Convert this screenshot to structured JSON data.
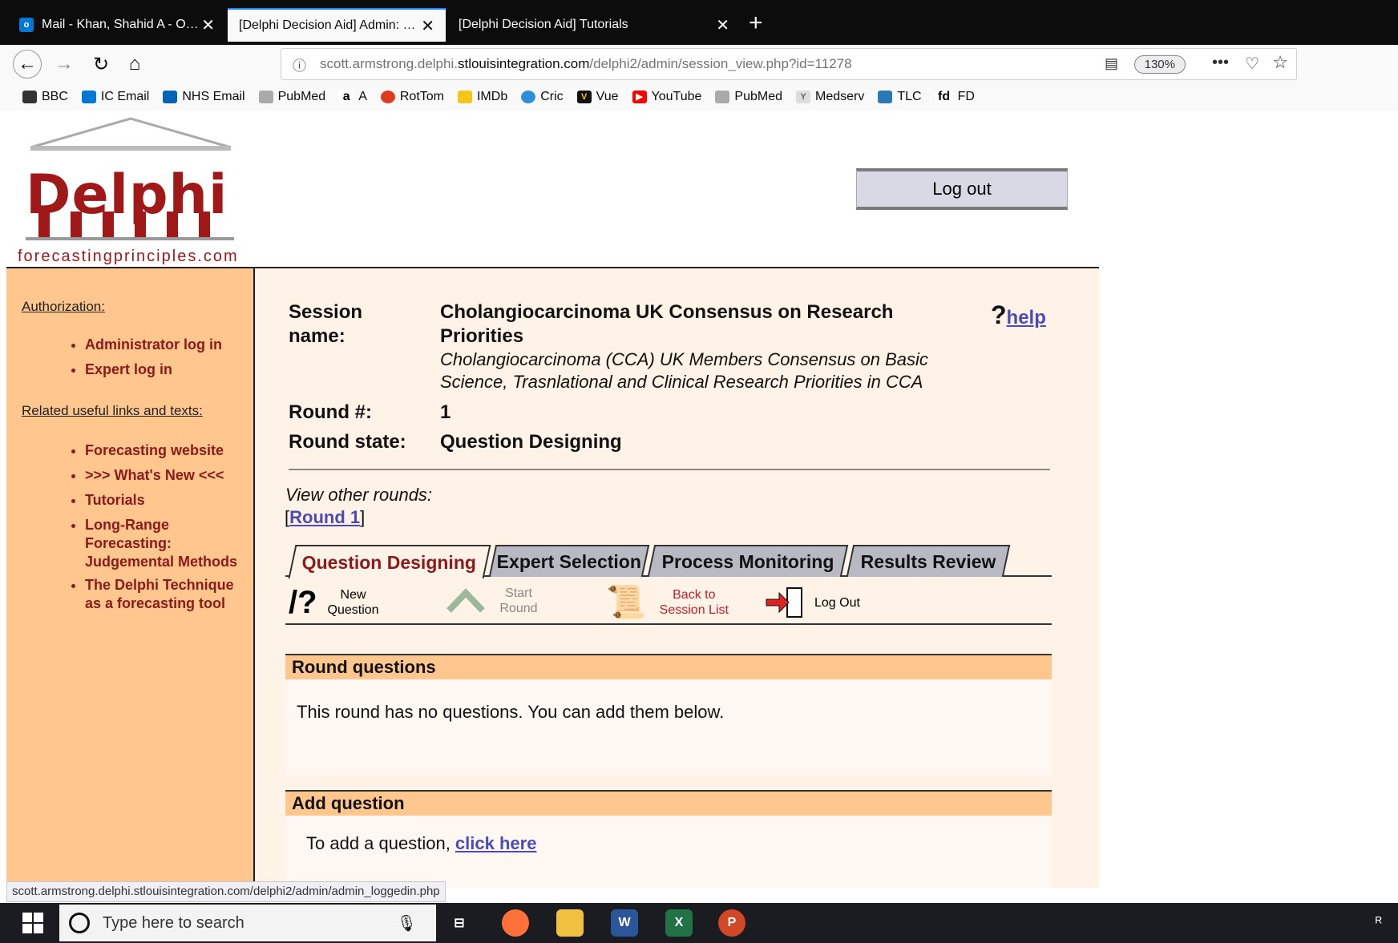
{
  "browser": {
    "tabs": [
      {
        "title": "Mail - Khan, Shahid A - Outlook",
        "favicon": "outlook-icon"
      },
      {
        "title": "[Delphi Decision Aid] Admin: View",
        "active": true
      },
      {
        "title": "[Delphi Decision Aid] Tutorials"
      }
    ],
    "url_prefix": "scott.armstrong.delphi.",
    "url_host": "stlouisintegration.com",
    "url_path": "/delphi2/admin/session_view.php?id=11278",
    "zoom": "130%",
    "bookmarks": [
      "BBC",
      "IC Email",
      "NHS Email",
      "PubMed",
      "A",
      "RotTom",
      "IMDb",
      "Cric",
      "Vue",
      "YouTube",
      "PubMed",
      "Medserv",
      "TLC",
      "FD"
    ],
    "status_url": "scott.armstrong.delphi.stlouisintegration.com/delphi2/admin/admin_loggedin.php"
  },
  "header": {
    "logo_text": "Delphi",
    "logo_sub": "forecastingprinciples.com",
    "logout_label": "Log out"
  },
  "sidebar": {
    "authorization_heading": "Authorization:",
    "auth_links": [
      "Administrator log in",
      "Expert log in"
    ],
    "related_heading": "Related useful links and texts:",
    "related_links": [
      "Forecasting website",
      ">>> What's New <<<",
      "Tutorials",
      "Long-Range Forecasting: Judgemental Methods",
      "The Delphi Technique as a forecasting tool"
    ]
  },
  "session": {
    "name_label": "Session name:",
    "name_value": "Cholangiocarcinoma UK Consensus on Research Priorities",
    "description": "Cholangiocarcinoma (CCA) UK Members Consensus on Basic Science, Trasnlational and Clinical Research Priorities in CCA",
    "round_label": "Round #:",
    "round_value": "1",
    "state_label": "Round state:",
    "state_value": "Question Designing",
    "help_mark": "?",
    "help_label": "help",
    "other_rounds_label": "View other rounds:",
    "round_link": "Round 1"
  },
  "phase_tabs": [
    "Question Designing",
    "Expert Selection",
    "Process Monitoring",
    "Results Review"
  ],
  "toolbar": {
    "new_question": "New Question",
    "start_round": "Start Round",
    "back_to_list": "Back to Session List",
    "log_out": "Log Out"
  },
  "sections": {
    "round_questions_title": "Round questions",
    "round_questions_text": "This round has no questions. You can add them below.",
    "add_question_title": "Add question",
    "add_question_prefix": "To add a question, ",
    "add_question_link": "click here"
  },
  "taskbar": {
    "search_placeholder": "Type here to search"
  },
  "colors": {
    "sidebar_bg": "#ffc68e",
    "main_bg": "#fff2e6",
    "link_red": "#8b1a1a",
    "link_blue": "#4b4bb8",
    "tab_off": "#b9b9c4"
  }
}
